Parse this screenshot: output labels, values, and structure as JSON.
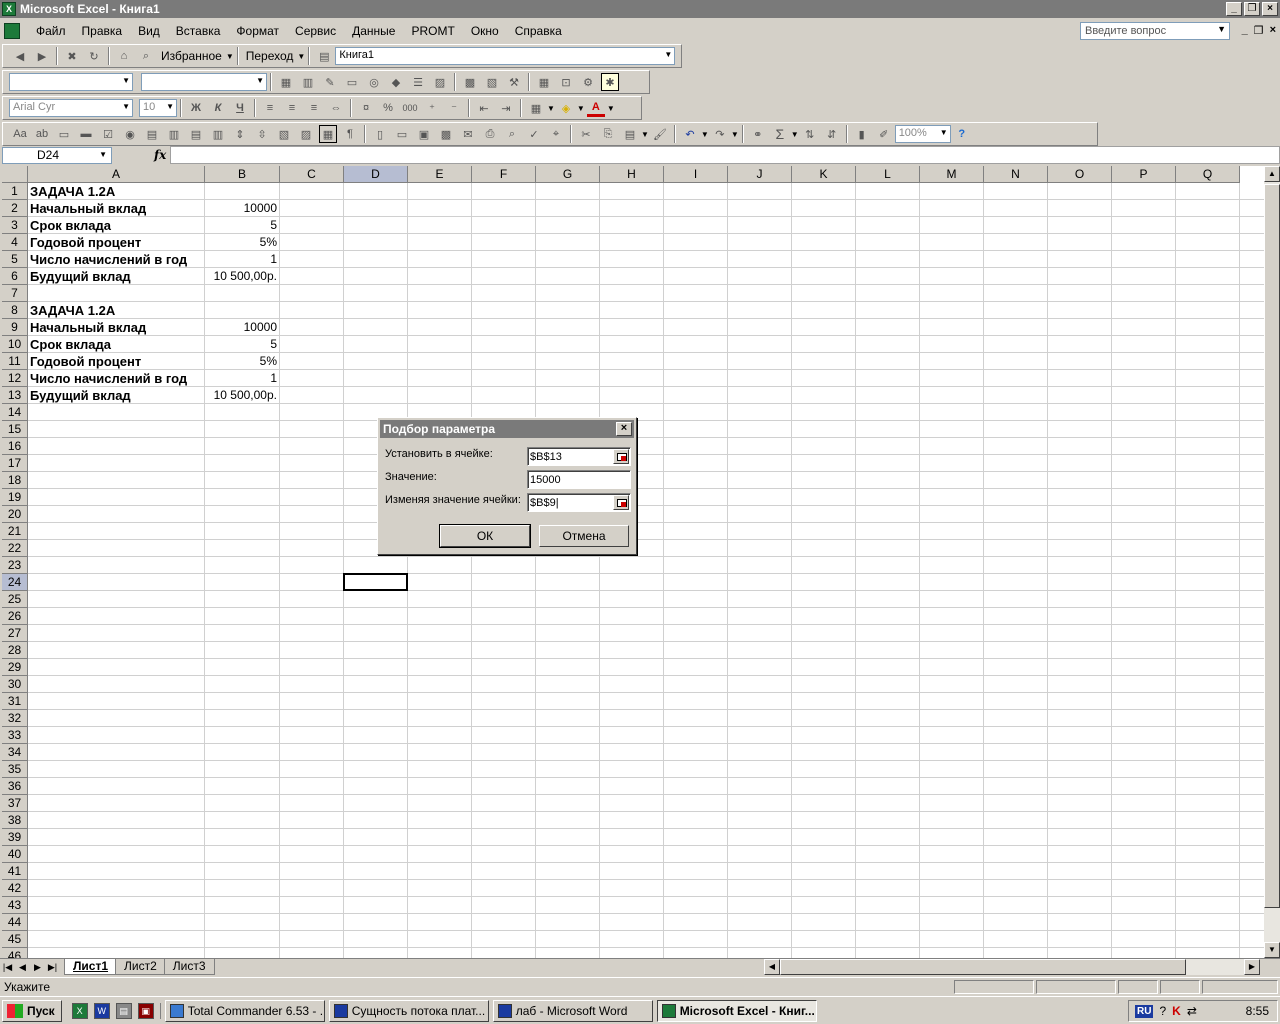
{
  "window": {
    "title": "Microsoft Excel - Книга1"
  },
  "menu": {
    "items": [
      "Файл",
      "Правка",
      "Вид",
      "Вставка",
      "Формат",
      "Сервис",
      "Данные",
      "PROMT",
      "Окно",
      "Справка"
    ],
    "question_placeholder": "Введите вопрос"
  },
  "web_toolbar": {
    "favorites_label": "Избранное",
    "go_label": "Переход",
    "address_value": "Книга1"
  },
  "format_toolbar": {
    "font_name": "Arial Cyr",
    "font_size": "10",
    "bold": "Ж",
    "italic": "К",
    "underline": "Ч",
    "percent": "%",
    "thousands": "000"
  },
  "standard_toolbar": {
    "zoom": "100%",
    "sum": "Σ"
  },
  "formula_bar": {
    "name_box": "D24",
    "fx": "fx",
    "formula": ""
  },
  "sheet": {
    "columns": [
      "A",
      "B",
      "C",
      "D",
      "E",
      "F",
      "G",
      "H",
      "I",
      "J",
      "K",
      "L",
      "M",
      "N",
      "O",
      "P",
      "Q"
    ],
    "rows": [
      "1",
      "2",
      "3",
      "4",
      "5",
      "6",
      "7",
      "8",
      "9",
      "10",
      "11",
      "12",
      "13",
      "14",
      "15",
      "16",
      "17",
      "18",
      "19",
      "20",
      "21",
      "22",
      "23",
      "24",
      "25",
      "26",
      "27",
      "28",
      "29",
      "30",
      "31",
      "32",
      "33",
      "34",
      "35",
      "36",
      "37",
      "38",
      "39",
      "40",
      "41",
      "42",
      "43",
      "44",
      "45",
      "46"
    ],
    "selected_column": "D",
    "selected_row": "24",
    "cells": [
      {
        "row": 1,
        "a": "ЗАДАЧА 1.2А",
        "b": ""
      },
      {
        "row": 2,
        "a": "Начальный вклад",
        "b": "10000"
      },
      {
        "row": 3,
        "a": "Срок вклада",
        "b": "5"
      },
      {
        "row": 4,
        "a": "Годовой процент",
        "b": "5%"
      },
      {
        "row": 5,
        "a": "Число начислений в год",
        "b": "1"
      },
      {
        "row": 6,
        "a": "Будущий вклад",
        "b": "10 500,00р."
      },
      {
        "row": 8,
        "a": "ЗАДАЧА 1.2А",
        "b": ""
      },
      {
        "row": 9,
        "a": "Начальный вклад",
        "b": "10000"
      },
      {
        "row": 10,
        "a": "Срок вклада",
        "b": "5"
      },
      {
        "row": 11,
        "a": "Годовой процент",
        "b": "5%"
      },
      {
        "row": 12,
        "a": "Число начислений в год",
        "b": "1"
      },
      {
        "row": 13,
        "a": "Будущий вклад",
        "b": "10 500,00р."
      }
    ],
    "tabs": [
      "Лист1",
      "Лист2",
      "Лист3"
    ],
    "active_tab": "Лист1"
  },
  "dialog": {
    "title": "Подбор параметра",
    "set_cell_label": "Установить в ячейке:",
    "set_cell_value": "$B$13",
    "value_label": "Значение:",
    "value_value": "15000",
    "changing_label": "Изменяя значение ячейки:",
    "changing_value": "$B$9",
    "ok_label": "ОК",
    "cancel_label": "Отмена"
  },
  "status": {
    "text": "Укажите"
  },
  "taskbar": {
    "start_label": "Пуск",
    "tasks": [
      {
        "label": "Total Commander 6.53 - ...",
        "active": false
      },
      {
        "label": "Сущность потока плат...",
        "active": false
      },
      {
        "label": "лаб - Microsoft Word",
        "active": false
      },
      {
        "label": "Microsoft Excel - Книг...",
        "active": true
      }
    ],
    "lang": "RU",
    "clock": "8:55"
  },
  "colors": {
    "title_inactive": "#7a7a7a",
    "selection_header": "#b6bdd2",
    "chrome": "#d4d0c8"
  }
}
